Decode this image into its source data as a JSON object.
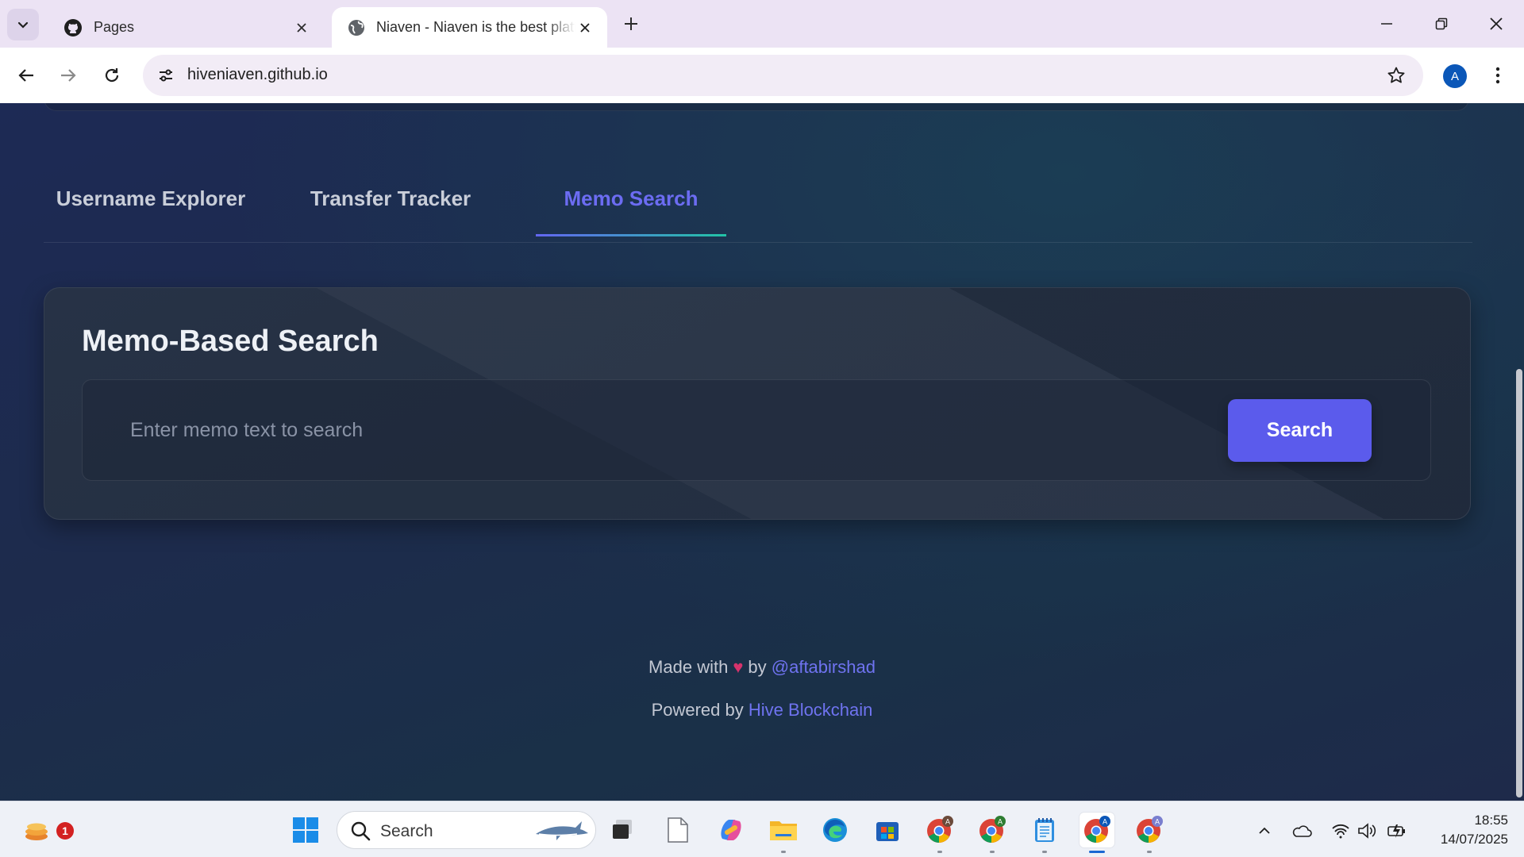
{
  "browser": {
    "tabs": [
      {
        "title": "Pages",
        "icon": "github-icon",
        "active": false
      },
      {
        "title": "Niaven - Niaven is the best platform",
        "icon": "globe-icon",
        "active": true
      }
    ],
    "url": "hiveniaven.github.io",
    "profile_initial": "A"
  },
  "page": {
    "nav_tabs": [
      {
        "label": "Username Explorer",
        "selected": false
      },
      {
        "label": "Transfer Tracker",
        "selected": false
      },
      {
        "label": "Memo Search",
        "selected": true
      }
    ],
    "card": {
      "title": "Memo-Based Search",
      "input_value": "",
      "input_placeholder": "Enter memo text to search",
      "button_label": "Search"
    },
    "footer": {
      "made_with": "Made with",
      "by": "by",
      "author": "@aftabirshad",
      "powered_by": "Powered by",
      "platform": "Hive Blockchain"
    },
    "colors": {
      "accent": "#5b5bec",
      "link": "#6f73f0",
      "tab_underline_start": "#6366f1",
      "tab_underline_end": "#22c3a6"
    }
  },
  "taskbar": {
    "search_label": "Search",
    "notification_count": "1",
    "time": "18:55",
    "date": "14/07/2025",
    "apps": [
      "widgets-icon",
      "start-icon",
      "task-view-icon",
      "file-icon",
      "copilot-icon",
      "file-explorer-icon",
      "edge-icon",
      "store-icon",
      "chrome-icon",
      "chrome-icon",
      "notepad-icon",
      "chrome-icon",
      "chrome-icon"
    ]
  }
}
